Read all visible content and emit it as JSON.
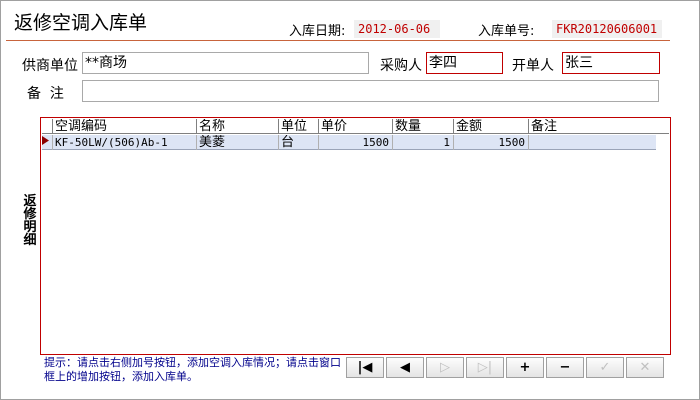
{
  "title": "返修空调入库单",
  "meta": {
    "date_label": "入库日期:",
    "date_value": "2012-06-06",
    "order_label": "入库单号:",
    "order_value": "FKR20120606001"
  },
  "form": {
    "supplier_label": "供商单位",
    "supplier_value": "**商场",
    "purchaser_label": "采购人",
    "purchaser_value": "李四",
    "creator_label": "开单人",
    "creator_value": "张三",
    "note_label": "备  注",
    "note_value": ""
  },
  "grid": {
    "side_label": "返修明细",
    "columns": [
      "空调编码",
      "名称",
      "单位",
      "单价",
      "数量",
      "金额",
      "备注"
    ],
    "rows": [
      [
        "KF-50LW/(506)Ab-1",
        "美菱",
        "台",
        "1500",
        "1",
        "1500",
        ""
      ]
    ]
  },
  "hint": "提示：请点击右侧加号按钮，添加空调入库情况；请点击窗口框上的增加按钮，添加入库单。",
  "nav": {
    "first": "|◀",
    "prev": "◀",
    "next": "▷",
    "last": "▷|",
    "add": "+",
    "remove": "−",
    "confirm": "✓",
    "cancel": "✕"
  }
}
